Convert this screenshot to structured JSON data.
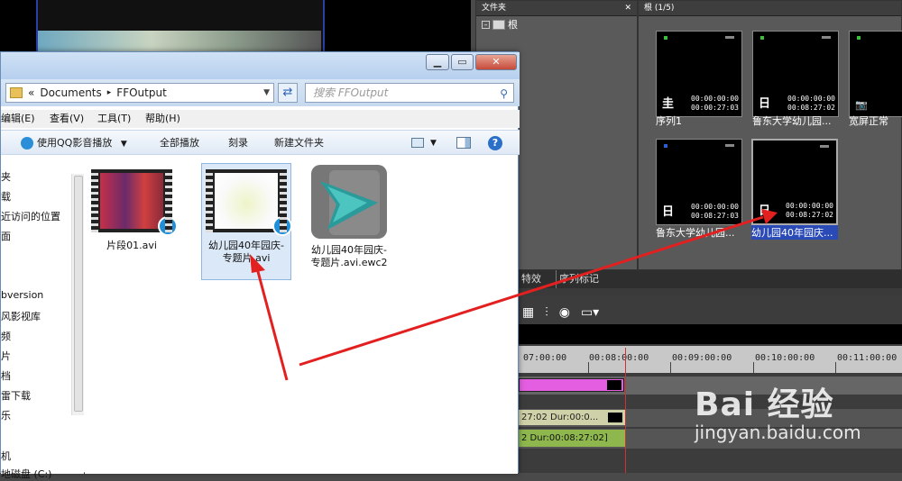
{
  "editor": {
    "folder_panel": {
      "title": "文件夹",
      "close": "✕",
      "root": "根"
    },
    "bin_panel": {
      "title": "根 (1/5)"
    },
    "clips": [
      {
        "timecode1": "00:00:00:00",
        "timecode2": "00:00:27:03",
        "icon": "圭",
        "label": "序列1",
        "dot_color": "#3cbd3c"
      },
      {
        "timecode1": "00:00:00:00",
        "timecode2": "00:08:27:02",
        "icon": "日",
        "label": "鲁东大学幼儿园...",
        "dot_color": "#3cbd3c"
      },
      {
        "timecode1": "",
        "timecode2": "",
        "icon": "📷",
        "label": "宽屏正常",
        "dot_color": "#3cbd3c"
      },
      {
        "timecode1": "00:00:00:00",
        "timecode2": "00:08:27:03",
        "icon": "日",
        "label": "鲁东大学幼儿园...",
        "dot_color": "#2a5fd0"
      },
      {
        "timecode1": "00:00:00:00",
        "timecode2": "00:08:27:02",
        "icon": "日",
        "label": "幼儿园40年园庆...",
        "dot_color": ""
      }
    ],
    "tabs": [
      "特效",
      "序列标记"
    ],
    "timeline": {
      "ruler": [
        "07:00:00",
        "00:08:00:00",
        "00:09:00:00",
        "00:10:00:00",
        "00:11:00:00"
      ],
      "clip_video2": "27:02 Dur:00:0...",
      "clip_audio": "2 Dur:00:08:27:02]"
    }
  },
  "explorer": {
    "window_buttons": {
      "minimize": "▁",
      "maximize": "▭",
      "close": "✕"
    },
    "address": {
      "chevron": "«",
      "path1": "Documents",
      "sep": "▸",
      "path2": "FFOutput",
      "dropdown": "▼"
    },
    "search_placeholder": "搜索 FFOutput",
    "menu": [
      "编辑(E)",
      "查看(V)",
      "工具(T)",
      "帮助(H)"
    ],
    "commands": {
      "play_qq": "使用QQ影音播放",
      "play_qq_dd": "▼",
      "play_all": "全部播放",
      "burn": "刻录",
      "new_folder": "新建文件夹",
      "view_dd": "▼",
      "help": "?"
    },
    "nav": [
      "夹",
      "载",
      "近访问的位置",
      "面",
      "bversion",
      "风影视库",
      "频",
      "片",
      "档",
      "雷下载",
      "乐",
      "机",
      "地磁盘 (C:)"
    ],
    "files": [
      {
        "name1": "片段01.avi",
        "name2": ""
      },
      {
        "name1": "幼儿园40年园庆-",
        "name2": "专题片.avi"
      },
      {
        "name1": "幼儿园40年园庆-",
        "name2": "专题片.avi.ewc2"
      }
    ]
  },
  "watermark": {
    "logo": "Bai   经验",
    "url": "jingyan.baidu.com"
  },
  "colors": {
    "arrow": "#e32020",
    "selection": "#2a4ab8"
  }
}
